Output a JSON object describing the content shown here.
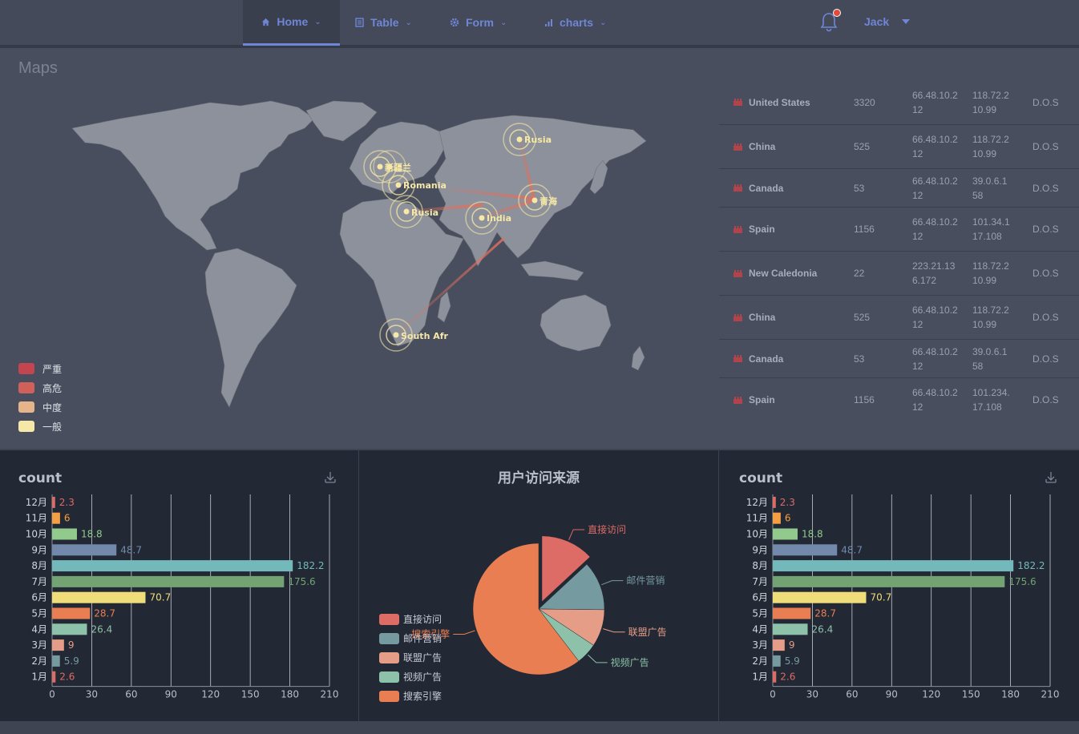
{
  "nav": {
    "items": [
      {
        "label": "Home",
        "icon": "home-icon",
        "active": true
      },
      {
        "label": "Table",
        "icon": "table-icon",
        "active": false
      },
      {
        "label": "Form",
        "icon": "gear-icon",
        "active": false
      },
      {
        "label": "charts",
        "icon": "bar-chart-icon",
        "active": false
      }
    ],
    "user": "Jack"
  },
  "maps": {
    "title": "Maps",
    "markers": [
      {
        "label": "Rusia"
      },
      {
        "label": "新疆兰"
      },
      {
        "label": "Romania"
      },
      {
        "label": "Rusia"
      },
      {
        "label": "India"
      },
      {
        "label": "青海"
      },
      {
        "label": "South Afr"
      }
    ],
    "legend": [
      {
        "label": "严重",
        "color": "#c2454f"
      },
      {
        "label": "高危",
        "color": "#d0605a"
      },
      {
        "label": "中度",
        "color": "#e6b48a"
      },
      {
        "label": "一般",
        "color": "#f6e8a6"
      }
    ]
  },
  "table": {
    "rows": [
      {
        "country": "United States",
        "count": "3320",
        "ip1": "66.48.10.212",
        "ip2": "118.72.210.99",
        "type": "D.O.S"
      },
      {
        "country": "China",
        "count": "525",
        "ip1": "66.48.10.212",
        "ip2": "118.72.210.99",
        "type": "D.O.S"
      },
      {
        "country": "Canada",
        "count": "53",
        "ip1": "66.48.10.212",
        "ip2": "39.0.6.158",
        "type": "D.O.S"
      },
      {
        "country": "Spain",
        "count": "1156",
        "ip1": "66.48.10.212",
        "ip2": "101.34.117.108",
        "type": "D.O.S"
      },
      {
        "country": "New Caledonia",
        "count": "22",
        "ip1": "223.21.136.172",
        "ip2": "118.72.210.99",
        "type": "D.O.S"
      },
      {
        "country": "China",
        "count": "525",
        "ip1": "66.48.10.212",
        "ip2": "118.72.210.99",
        "type": "D.O.S"
      },
      {
        "country": "Canada",
        "count": "53",
        "ip1": "66.48.10.212",
        "ip2": "39.0.6.158",
        "type": "D.O.S"
      },
      {
        "country": "Spain",
        "count": "1156",
        "ip1": "66.48.10.212",
        "ip2": "101.234.17.108",
        "type": "D.O.S"
      }
    ]
  },
  "chart_data": [
    {
      "type": "bar",
      "title": "count",
      "orientation": "horizontal",
      "categories": [
        "1月",
        "2月",
        "3月",
        "4月",
        "5月",
        "6月",
        "7月",
        "8月",
        "9月",
        "10月",
        "11月",
        "12月"
      ],
      "values": [
        2.6,
        5.9,
        9,
        26.4,
        28.7,
        70.7,
        175.6,
        182.2,
        48.7,
        18.8,
        6,
        2.3
      ],
      "colors": [
        "#dd6b66",
        "#759aa0",
        "#e69d87",
        "#8dc1a9",
        "#ea7e53",
        "#eedd78",
        "#73a373",
        "#73b9bc",
        "#7289ab",
        "#91ca8c",
        "#f49f42",
        "#dd6b66"
      ],
      "xlim": [
        0,
        210
      ],
      "xticks": [
        "0",
        "30",
        "60",
        "90",
        "120",
        "150",
        "180",
        "210"
      ],
      "grid": "vertical lines"
    },
    {
      "type": "pie",
      "title": "用户访问来源",
      "legend_position": "left-bottom",
      "slices": [
        {
          "name": "直接访问",
          "value": 335,
          "color": "#dd6b66"
        },
        {
          "name": "邮件营销",
          "value": 310,
          "color": "#759aa0"
        },
        {
          "name": "联盟广告",
          "value": 234,
          "color": "#e69d87"
        },
        {
          "name": "视频广告",
          "value": 135,
          "color": "#8dc1a9"
        },
        {
          "name": "搜索引擎",
          "value": 1548,
          "color": "#ea7e53"
        }
      ]
    },
    {
      "type": "bar",
      "title": "count",
      "orientation": "horizontal",
      "categories": [
        "1月",
        "2月",
        "3月",
        "4月",
        "5月",
        "6月",
        "7月",
        "8月",
        "9月",
        "10月",
        "11月",
        "12月"
      ],
      "values": [
        2.6,
        5.9,
        9,
        26.4,
        28.7,
        70.7,
        175.6,
        182.2,
        48.7,
        18.8,
        6,
        2.3
      ],
      "colors": [
        "#dd6b66",
        "#759aa0",
        "#e69d87",
        "#8dc1a9",
        "#ea7e53",
        "#eedd78",
        "#73a373",
        "#73b9bc",
        "#7289ab",
        "#91ca8c",
        "#f49f42",
        "#dd6b66"
      ],
      "xlim": [
        0,
        210
      ],
      "xticks": [
        "0",
        "30",
        "60",
        "90",
        "120",
        "150",
        "180",
        "210"
      ],
      "grid": "vertical lines"
    }
  ]
}
